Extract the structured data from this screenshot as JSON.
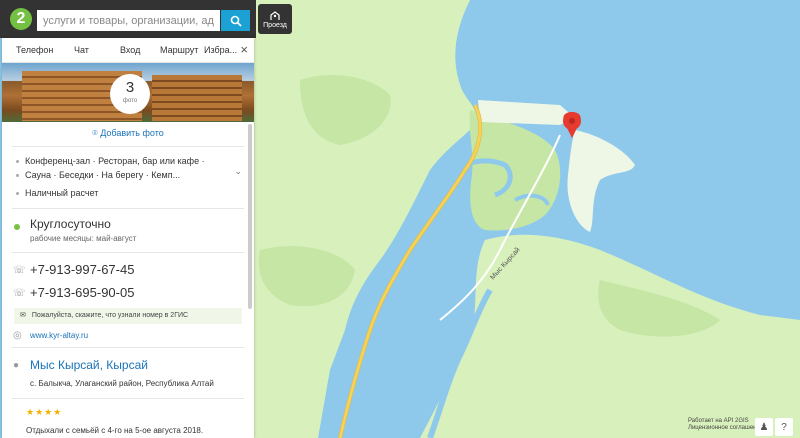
{
  "search": {
    "placeholder": "услуги и товары, организации, адреса"
  },
  "route_button": {
    "label": "Проезд"
  },
  "tabs": [
    "Телефон",
    "Чат",
    "Вход",
    "Маршрут",
    "Избра..."
  ],
  "photo": {
    "count": "3",
    "caption": "фото"
  },
  "add_photo_label": "Добавить фото",
  "features": {
    "line1": "Конференц-зал · Ресторан, бар или кафе ·",
    "line2": "Сауна · Беседки · На берегу · Кемп...",
    "line3": "Наличный расчет"
  },
  "hours": {
    "main": "Круглосуточно",
    "sub": "рабочие месяцы: май-август"
  },
  "phones": [
    "+7-913-997-67-45",
    "+7-913-695-90-05"
  ],
  "note": "Пожалуйста, скажите, что узнали номер в 2ГИС",
  "website": "www.kyr-altay.ru",
  "place": {
    "name": "Мыс Кырсай, Кырсай",
    "address": "с. Балыкча, Улаганский район, Республика Алтай"
  },
  "review": {
    "stars": "★★★★",
    "text": "Отдыхали с семьёй с 4-го на 5-ое августа 2018."
  },
  "map": {
    "road_label": "Мыс Кырсай"
  },
  "credits": {
    "line1": "Работает на API 2GIS",
    "line2": "Лицензионное соглашение"
  },
  "colors": {
    "water": "#8ec9ec",
    "land": "#d8f0bc",
    "land_dark": "#c5e6a5",
    "road": "#f5d35c",
    "accent": "#1ba1d4",
    "pin": "#e63b2e"
  }
}
